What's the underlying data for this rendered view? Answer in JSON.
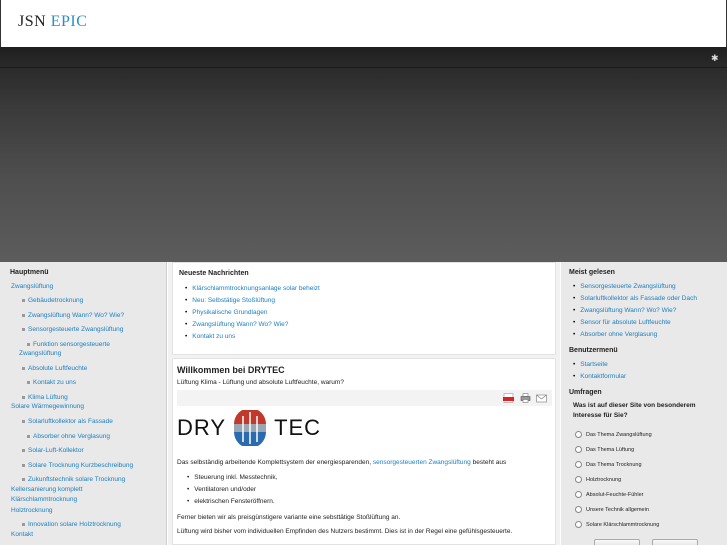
{
  "header": {
    "logo_part1": "JSN",
    "logo_part2": "EPIC"
  },
  "left": {
    "title": "Hauptmenü",
    "items": [
      "Zwangslüftung",
      "Gebäudetrocknung",
      "Zwangslüftung Wann? Wo? Wie?",
      "Sensorgesteuerte Zwangslüftung",
      "Funktion sensorgesteuerte",
      "Zwangslüftung",
      "Absolute Luftfeuchte",
      "Kontakt zu uns",
      "Klima Lüftung",
      "Solare Wärmegewinnung",
      "Solarluftkollektor als Fassade",
      "Absorber ohne Verglasung",
      "Solar-Luft-Kollektor",
      "Solare Trocknung Kurzbeschreibung",
      "Zukunftstechnik solare Trocknung",
      "Kellersanierung komplett",
      "Klärschlammtrocknung",
      "Holztrocknung",
      "Innovation solare Holztrocknung",
      "Kontakt"
    ]
  },
  "news": {
    "title": "Neueste Nachrichten",
    "items": [
      "Klärschlammtrocknungsanlage solar beheizt",
      "Neu: Selbstätige Stoßlüftung",
      "Physikalische Grundlagen",
      "Zwangslüftung Wann? Wo? Wie?",
      "Kontakt zu uns"
    ]
  },
  "article": {
    "title": "Willkommen bei DRYTEC",
    "subtitle": "Lüftung Klima - Lüftung und absolute Luftfeuchte, warum?",
    "logo_left": "DRY",
    "logo_right": "TEC",
    "p1_before": "Das selbständig arbeitende Komplettsystem der energiesparenden, ",
    "p1_link": "sensorgesteuerten Zwangslüftung",
    "p1_after": " besteht aus",
    "bullets": [
      "Steuerung inkl. Messtechnik,",
      "Ventilatoren und/oder",
      "elektrischen Fensteröffnern."
    ],
    "p2": "Ferner bieten wir als preisgünstigere variante eine sebsttätige Stoßlüftung an.",
    "p3": "Lüftung wird bisher vom individuellen Empfinden des Nutzers bestimmt. Dies ist in der Regel eine gefühlsgesteuerte."
  },
  "right": {
    "popular_title": "Meist gelesen",
    "popular": [
      "Sensorgesteuerte Zwangslüftung",
      "Solarluftkollektor als Fassade oder Dach",
      "Zwangslüftung Wann? Wo? Wie?",
      "Sensor für absolute Luftfeuchte",
      "Absorber ohne Verglasung"
    ],
    "usermenu_title": "Benutzermenü",
    "usermenu": [
      "Startseite",
      "Kontaktformular"
    ],
    "poll_title": "Umfragen",
    "poll_question": "Was ist auf dieser Site von besonderem Interesse für Sie?",
    "poll_options": [
      "Das Thema Zwangslüftung",
      "Das Thema Lüftung",
      "Das Thema Trocknung",
      "Holztrocknung",
      "Absolut-Feuchte-Fühler",
      "Unsere Technik allgemein",
      "Solare Klärschlammtrocknung"
    ]
  },
  "colors": {
    "link": "#1a7fc0",
    "logo_accent": "#2a8fc8"
  }
}
